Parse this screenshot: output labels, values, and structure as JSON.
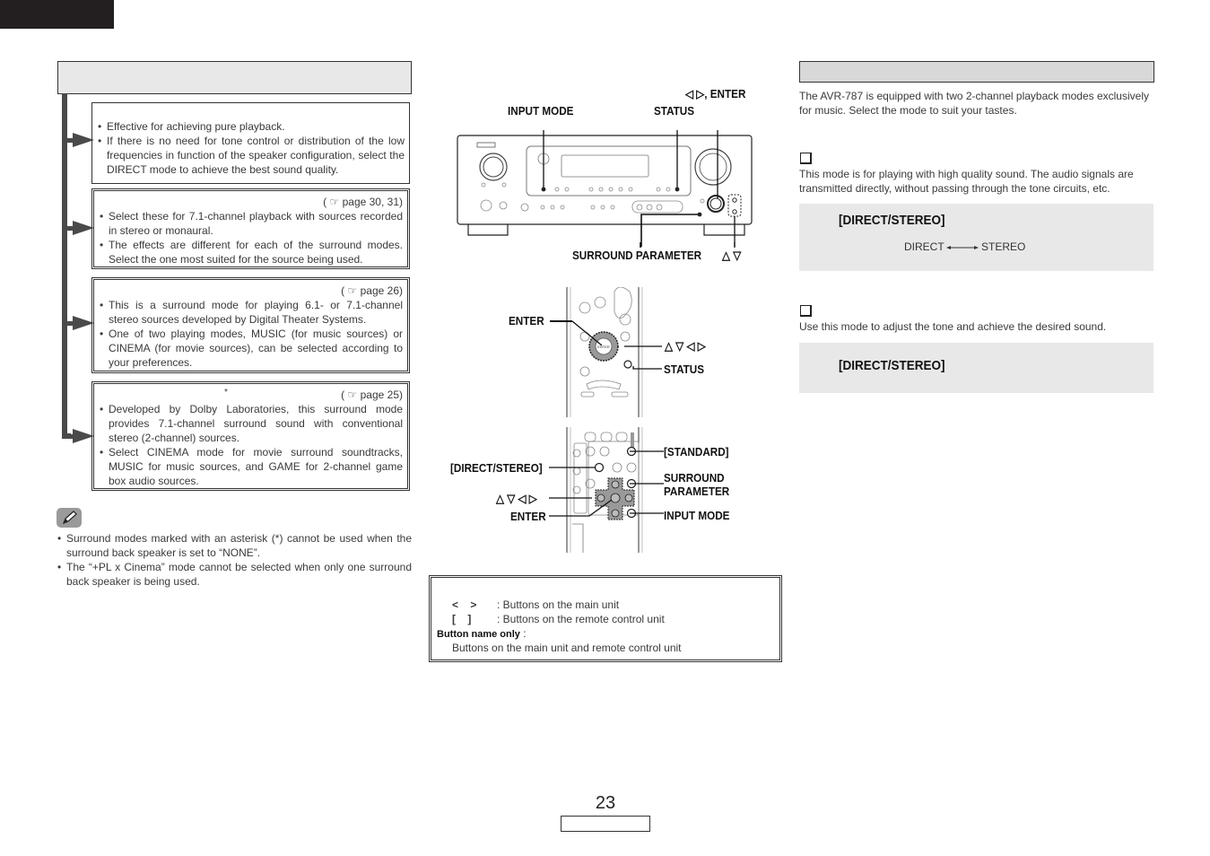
{
  "page": {
    "number": "23"
  },
  "left": {
    "modes": [
      {
        "ref": "",
        "bullets": [
          "Effective for achieving pure playback.",
          "If there is no need for tone control or distribution of the low frequencies in function of the speaker configuration, select the DIRECT mode to achieve the best sound quality."
        ]
      },
      {
        "ref_page": "page 30, 31",
        "bullets": [
          "Select these for 7.1-channel playback with sources recorded in stereo or monaural.",
          "The effects are different for each of the surround modes. Select the one most suited for the source being used."
        ]
      },
      {
        "ref_page": "page 26",
        "bullets": [
          "This is a surround mode for playing 6.1- or 7.1-channel stereo sources developed by Digital Theater Systems.",
          "One of two playing modes, MUSIC (for music sources) or CINEMA (for movie sources), can be selected according to your preferences."
        ]
      },
      {
        "asterisk": "*",
        "ref_page": "page 25",
        "bullets": [
          "Developed by Dolby Laboratories, this surround mode provides 7.1-channel surround sound with conventional stereo (2-channel) sources.",
          "Select CINEMA mode for movie surround soundtracks, MUSIC for music sources, and GAME for 2-channel game box audio sources."
        ]
      }
    ],
    "notes_icon": "pencil-icon",
    "notes": [
      "Surround modes marked with an asterisk (*) cannot be used when the surround back speaker is set to “NONE”.",
      "The “+PL x Cinema” mode cannot be selected when only one surround back speaker is being used."
    ]
  },
  "diagram": {
    "main_unit": {
      "labels": {
        "input_mode": "INPUT MODE",
        "status": "STATUS",
        "left_right_enter": "◁ ▷, ENTER",
        "surround_parameter": "SURROUND PARAMETER",
        "up_down": "△ ▽"
      }
    },
    "remote_top": {
      "labels": {
        "enter": "ENTER",
        "arrows": "△ ▽ ◁ ▷",
        "status": "STATUS"
      }
    },
    "remote_bottom": {
      "labels": {
        "standard": "[STANDARD]",
        "direct_stereo": "[DIRECT/STEREO]",
        "surround_parameter_1": "SURROUND",
        "surround_parameter_2": "PARAMETER",
        "arrows": "△ ▽ ◁ ▷",
        "enter": "ENTER",
        "input_mode": "INPUT MODE"
      }
    }
  },
  "legend": {
    "main_unit_symbol": "<    >",
    "main_unit_desc": ": Buttons on the main unit",
    "remote_symbol": "[    ]",
    "remote_desc": ": Buttons on the remote control unit",
    "name_only_label": "Button name only",
    "name_only_colon": " :",
    "name_only_desc": "Buttons on the main unit and remote control unit"
  },
  "right": {
    "intro": "The AVR-787 is equipped with two 2-channel playback modes exclusively for music. Select the mode to suit your tastes.",
    "direct_desc": "This mode is for playing with high quality sound. The audio signals are transmitted directly, without passing through the tone circuits, etc.",
    "panel1": {
      "button": "[DIRECT/STEREO]",
      "from": "DIRECT",
      "to": "STEREO"
    },
    "stereo_desc": "Use this mode to adjust the tone and achieve the desired sound.",
    "panel2": {
      "button": "[DIRECT/STEREO]"
    }
  }
}
